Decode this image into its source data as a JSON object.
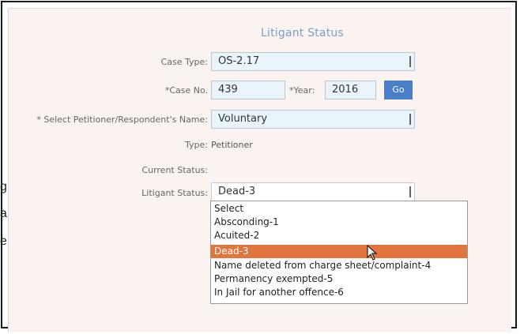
{
  "form": {
    "title": "Litigant Status",
    "case_type": {
      "label": "Case Type:",
      "value": "OS-2.17"
    },
    "case_no": {
      "label": "*Case No.",
      "value": "439"
    },
    "year": {
      "label": "*Year:",
      "value": "2016"
    },
    "go_label": "Go",
    "party_name": {
      "label": "* Select Petitioner/Respondent's Name:",
      "value": "Voluntary"
    },
    "type": {
      "label": "Type:",
      "value": "Petitioner"
    },
    "current_status": {
      "label": "Current Status:",
      "value": ""
    },
    "litigant_status": {
      "label": "Litigant Status:",
      "value": "Dead-3",
      "options": [
        "Select",
        "Absconding-1",
        "Acuited-2",
        "Dead-3",
        "Name deleted from charge sheet/complaint-4",
        "Permanency exempted-5",
        "In Jail for another offence-6"
      ],
      "highlighted_index": 3
    }
  },
  "edge_text": [
    "g",
    "a",
    "e",
    ","
  ],
  "colors": {
    "title": "#7aa0c8",
    "field_bg": "#e9f4fb",
    "go_button": "#4a7fc8",
    "highlight": "#e2743e",
    "panel_bg": "#fbf3f0"
  },
  "icons": {
    "cursor": "mouse-pointer-icon"
  }
}
